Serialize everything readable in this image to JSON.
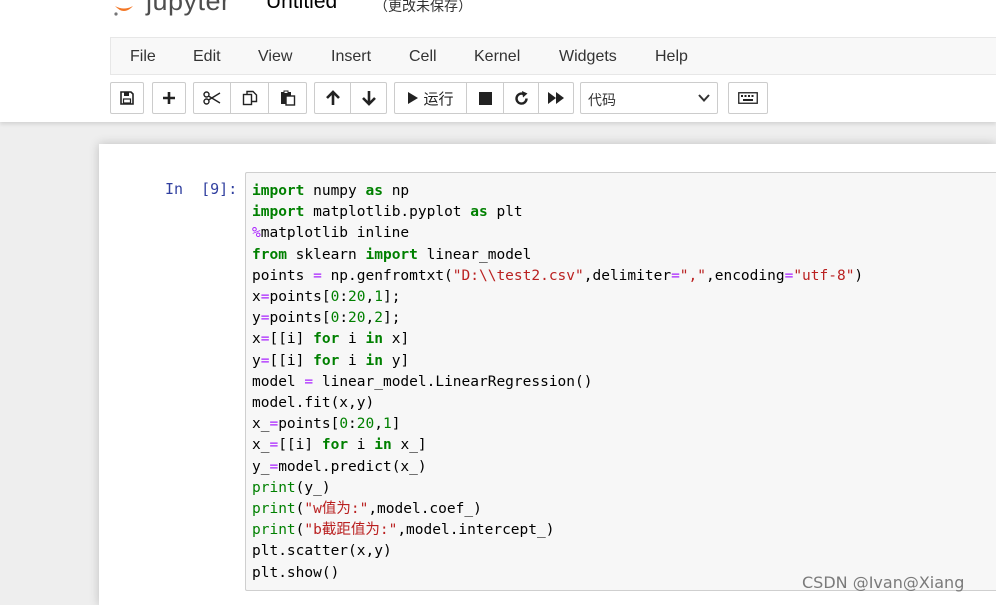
{
  "header": {
    "logo_text": "jupyter",
    "notebook_name": "Untitled",
    "save_status": "（更改未保存）"
  },
  "menu": [
    "File",
    "Edit",
    "View",
    "Insert",
    "Cell",
    "Kernel",
    "Widgets",
    "Help"
  ],
  "toolbar": {
    "save_icon": "floppy-disk-icon",
    "insert_icon": "plus-icon",
    "cut_icon": "scissors-icon",
    "copy_icon": "copy-icon",
    "paste_icon": "paste-icon",
    "move_up_icon": "arrow-up-icon",
    "move_down_icon": "arrow-down-icon",
    "run_label": "运行",
    "interrupt_icon": "stop-icon",
    "restart_icon": "redo-icon",
    "run_all_icon": "fast-forward-icon",
    "cell_type": "代码",
    "keyboard_icon": "keyboard-icon"
  },
  "cell": {
    "prompt": "In  [9]:",
    "code_lines": [
      "import numpy as np",
      "import matplotlib.pyplot as plt",
      "%matplotlib inline",
      "from sklearn import linear_model",
      "points = np.genfromtxt(\"D:\\\\test2.csv\",delimiter=\",\",encoding=\"utf-8\")",
      "x=points[0:20,1];",
      "y=points[0:20,2];",
      "x=[[i] for i in x]",
      "y=[[i] for i in y]",
      "model = linear_model.LinearRegression()",
      "model.fit(x,y)",
      "x_=points[0:20,1]",
      "x_=[[i] for i in x_]",
      "y_=model.predict(x_)",
      "print(y_)",
      "print(\"w值为:\",model.coef_)",
      "print(\"b截距值为:\",model.intercept_)",
      "plt.scatter(x,y)",
      "plt.show()"
    ]
  },
  "watermark": "CSDN @Ivan@Xiang",
  "colors": {
    "keyword": "#008000",
    "string": "#ba2121",
    "magic": "#aa22ff",
    "prompt": "#303f9f",
    "logo_orange": "#f37726"
  }
}
